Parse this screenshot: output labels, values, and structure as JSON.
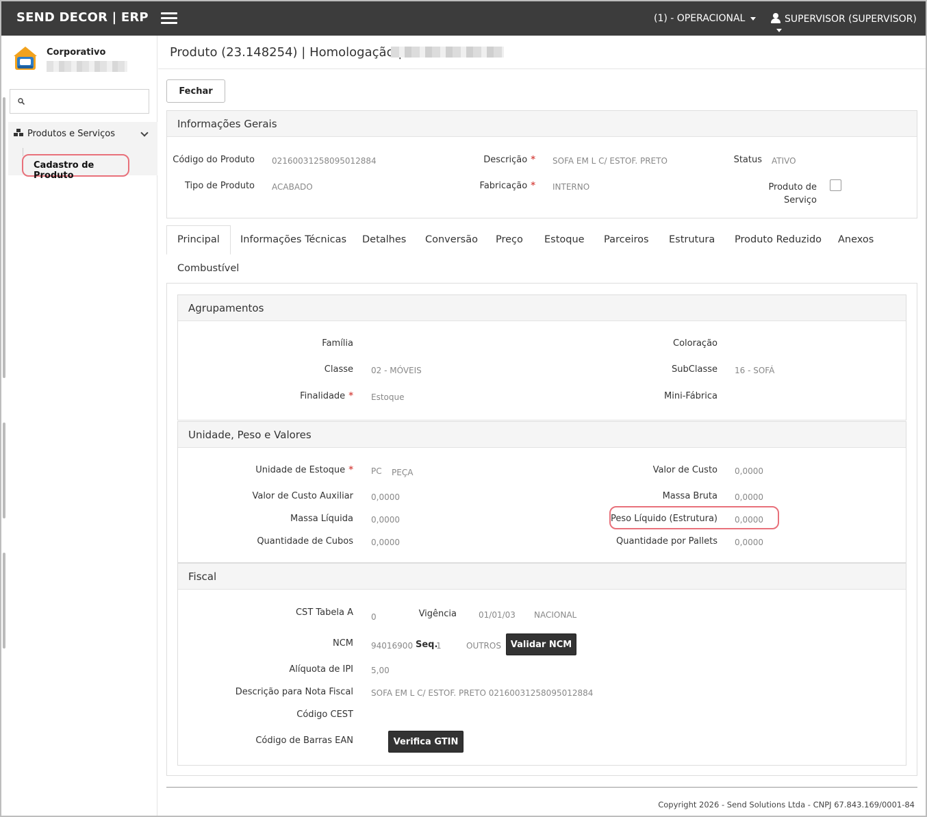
{
  "app": {
    "brand": "SEND DECOR | ERP",
    "environment": "(1) - OPERACIONAL",
    "user": "SUPERVISOR (SUPERVISOR)"
  },
  "sidebar": {
    "org_name": "Corporativo",
    "search_placeholder": "",
    "group_label": "Produtos e Serviços",
    "active_item": "Cadastro de Produto"
  },
  "page": {
    "title": "Produto (23.148254) | Homologação |",
    "close_label": "Fechar"
  },
  "general": {
    "heading": "Informações Gerais",
    "codigo_label": "Código do Produto",
    "codigo_value": "02160031258095012884",
    "descricao_label": "Descrição",
    "descricao_value": "SOFA EM L C/ ESTOF. PRETO",
    "status_label": "Status",
    "status_value": "ATIVO",
    "tipo_label": "Tipo de Produto",
    "tipo_value": "ACABADO",
    "fabricacao_label": "Fabricação",
    "fabricacao_value": "INTERNO",
    "produto_servico_label_1": "Produto de",
    "produto_servico_label_2": "Serviço",
    "produto_servico_checked": false
  },
  "tabs": [
    {
      "label": "Principal",
      "active": true
    },
    {
      "label": "Informações Técnicas"
    },
    {
      "label": "Detalhes"
    },
    {
      "label": "Conversão"
    },
    {
      "label": "Preço"
    },
    {
      "label": "Estoque"
    },
    {
      "label": "Parceiros"
    },
    {
      "label": "Estrutura"
    },
    {
      "label": "Produto Reduzido"
    },
    {
      "label": "Anexos"
    },
    {
      "label": "Combustível"
    }
  ],
  "agrupamentos": {
    "heading": "Agrupamentos",
    "familia_label": "Família",
    "coloracao_label": "Coloração",
    "classe_label": "Classe",
    "classe_value": "02 - MÓVEIS",
    "subclasse_label": "SubClasse",
    "subclasse_value": "16 - SOFÁ",
    "finalidade_label": "Finalidade",
    "finalidade_value": "Estoque",
    "minifabrica_label": "Mini-Fábrica"
  },
  "unidade": {
    "heading": "Unidade, Peso e Valores",
    "unidade_label": "Unidade de Estoque",
    "unidade_code": "PC",
    "unidade_name": "PEÇA",
    "valor_custo_label": "Valor de Custo",
    "valor_custo_value": "0,0000",
    "valor_aux_label": "Valor de Custo Auxiliar",
    "valor_aux_value": "0,0000",
    "massa_bruta_label": "Massa Bruta",
    "massa_bruta_value": "0,0000",
    "massa_liquida_label": "Massa Líquida",
    "massa_liquida_value": "0,0000",
    "peso_liquido_label": "Peso Líquido (Estrutura)",
    "peso_liquido_value": "0,0000",
    "cubos_label": "Quantidade de Cubos",
    "cubos_value": "0,0000",
    "pallets_label": "Quantidade por Pallets",
    "pallets_value": "0,0000"
  },
  "fiscal": {
    "heading": "Fiscal",
    "cst_label": "CST Tabela A",
    "cst_value": "0",
    "vigencia_label": "Vigência",
    "vigencia_value": "01/01/03",
    "origem_value": "NACIONAL",
    "ncm_label": "NCM",
    "ncm_value": "94016900",
    "seq_label": "Seq.",
    "seq_value": "1",
    "ncm_outros": "OUTROS",
    "validar_ncm_label": "Validar NCM",
    "ipi_label": "Alíquota de IPI",
    "ipi_value": "5,00",
    "desc_nf_label": "Descrição para Nota Fiscal",
    "desc_nf_value": "SOFA EM L C/ ESTOF. PRETO 02160031258095012884",
    "cest_label": "Código CEST",
    "ean_label": "Código de Barras EAN",
    "verifica_gtin_label": "Verifica GTIN"
  },
  "footer": {
    "copyright": "Copyright 2026 - Send Solutions Ltda - CNPJ 67.843.169/0001-84"
  },
  "colors": {
    "topbar": "#3c3c3c",
    "highlight": "#e8707a",
    "required": "#d9534f"
  }
}
